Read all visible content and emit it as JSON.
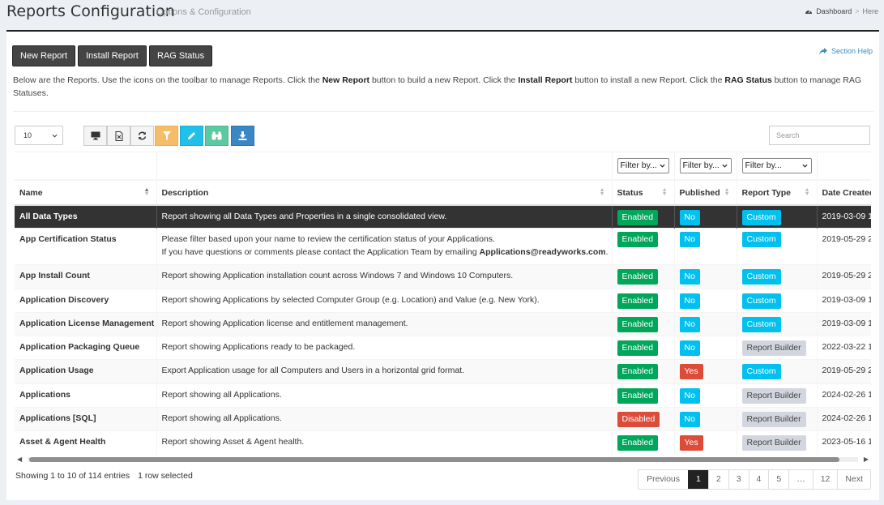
{
  "header": {
    "title": "Reports Configuration",
    "subtitle": "Options & Configuration",
    "breadcrumb": [
      "Dashboard",
      ">",
      "Here"
    ]
  },
  "toolbar": {
    "new_report": "New Report",
    "install_report": "Install Report",
    "rag_status": "RAG Status",
    "section_help": "Section Help"
  },
  "intro": {
    "p1": "Below are the Reports. Use the icons on the toolbar to manage Reports. Click the ",
    "b1": "New Report",
    "p2": " button to build a new Report. Click the ",
    "b2": "Install Report",
    "p3": " button to install a new Report. Click the ",
    "b3": "RAG Status",
    "p4": " button to manage RAG Statuses."
  },
  "table_controls": {
    "page_length": "10",
    "search_placeholder": "Search",
    "icons": [
      "monitor-icon",
      "export-file-icon",
      "refresh-icon",
      "filter-icon",
      "pencil-icon",
      "binoculars-icon",
      "download-icon"
    ]
  },
  "filters": {
    "status": "Filter by...",
    "published": "Filter by...",
    "report_type": "Filter by..."
  },
  "columns": [
    "Name",
    "Description",
    "Status",
    "Published",
    "Report Type",
    "Date Created"
  ],
  "rows": [
    {
      "name": "All Data Types",
      "desc": "Report showing all Data Types and Properties in a single consolidated view.",
      "status": "Enabled",
      "published": "No",
      "type": "Custom",
      "date": "2019-03-09 1"
    },
    {
      "name": "App Certification Status",
      "desc": "Please filter based upon your name to review the certification status of your Applications.",
      "desc2a": "If you have questions or comments please contact the Application Team by emailing ",
      "desc2b": "Applications@readyworks.com",
      "desc2c": ".",
      "status": "Enabled",
      "published": "No",
      "type": "Custom",
      "date": "2019-05-29 2"
    },
    {
      "name": "App Install Count",
      "desc": "Report showing Application installation count across Windows 7 and Windows 10 Computers.",
      "status": "Enabled",
      "published": "No",
      "type": "Custom",
      "date": "2019-05-29 2"
    },
    {
      "name": "Application Discovery",
      "desc": "Report showing Applications by selected Computer Group (e.g. Location) and Value (e.g. New York).",
      "status": "Enabled",
      "published": "No",
      "type": "Custom",
      "date": "2019-03-09 1"
    },
    {
      "name": "Application License Management",
      "desc": "Report showing Application license and entitlement management.",
      "status": "Enabled",
      "published": "No",
      "type": "Custom",
      "date": "2019-03-09 1"
    },
    {
      "name": "Application Packaging Queue",
      "desc": "Report showing Applications ready to be packaged.",
      "status": "Enabled",
      "published": "No",
      "type": "Report Builder",
      "date": "2022-03-22 1"
    },
    {
      "name": "Application Usage",
      "desc": "Export Application usage for all Computers and Users in a horizontal grid format.",
      "status": "Enabled",
      "published": "Yes",
      "type": "Custom",
      "date": "2019-05-29 2"
    },
    {
      "name": "Applications",
      "desc": "Report showing all Applications.",
      "status": "Enabled",
      "published": "No",
      "type": "Report Builder",
      "date": "2024-02-26 1"
    },
    {
      "name": "Applications [SQL]",
      "desc": "Report showing all Applications.",
      "status": "Disabled",
      "published": "No",
      "type": "Report Builder",
      "date": "2024-02-26 1"
    },
    {
      "name": "Asset & Agent Health",
      "desc": "Report showing Asset & Agent health.",
      "status": "Enabled",
      "published": "Yes",
      "type": "Report Builder",
      "date": "2023-05-16 1"
    }
  ],
  "footer": {
    "info": "Showing 1 to 10 of 114 entries",
    "selected": "1 row selected",
    "pager": [
      "Previous",
      "1",
      "2",
      "3",
      "4",
      "5",
      "…",
      "12",
      "Next"
    ]
  },
  "colors": {
    "enabled": "#00a65a",
    "disabled": "#dd4b39",
    "cyan": "#00c0ef",
    "gray": "#d2d6de",
    "selected_row": "#333333"
  }
}
